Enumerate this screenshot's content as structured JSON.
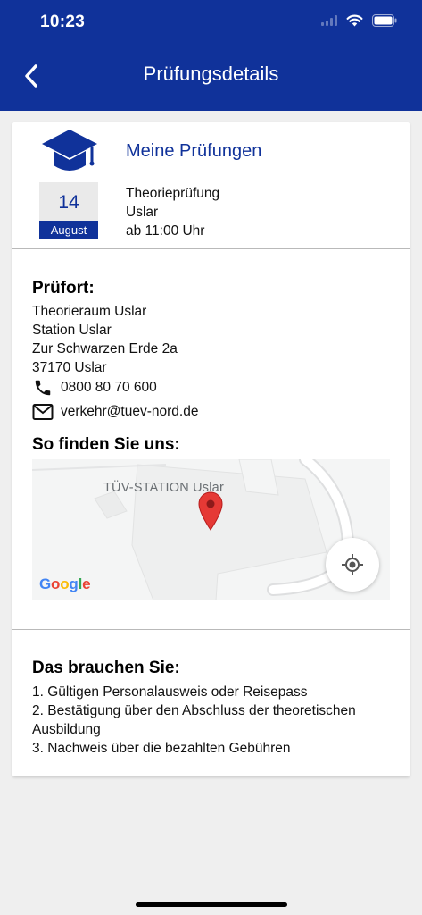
{
  "status": {
    "time": "10:23"
  },
  "header": {
    "title": "Prüfungsdetails"
  },
  "exam": {
    "section_title": "Meine Prüfungen",
    "day": "14",
    "month": "August",
    "type": "Theorieprüfung",
    "city": "Uslar",
    "time": "ab 11:00 Uhr"
  },
  "location": {
    "heading": "Prüfort:",
    "room": "Theorieraum Uslar",
    "station": "Station Uslar",
    "street": "Zur Schwarzen Erde 2a",
    "zip_city": "37170 Uslar",
    "phone": "0800 80 70 600",
    "email": "verkehr@tuev-nord.de"
  },
  "map": {
    "heading": "So finden Sie uns:",
    "label": "TÜV-STATION Uslar",
    "provider": "Google"
  },
  "requirements": {
    "heading": "Das brauchen Sie:",
    "items": [
      "1. Gültigen Personalausweis oder Reisepass",
      "2. Bestätigung über den Abschluss der theoretischen Ausbildung",
      "3. Nachweis über die bezahlten Gebühren"
    ]
  },
  "colors": {
    "brand": "#10329a",
    "pin": "#e53935"
  },
  "icons": [
    "chevron-left-icon",
    "graduation-cap-icon",
    "phone-icon",
    "mail-icon",
    "map-pin-icon",
    "locate-icon",
    "wifi-icon",
    "battery-icon",
    "signal-icon"
  ]
}
